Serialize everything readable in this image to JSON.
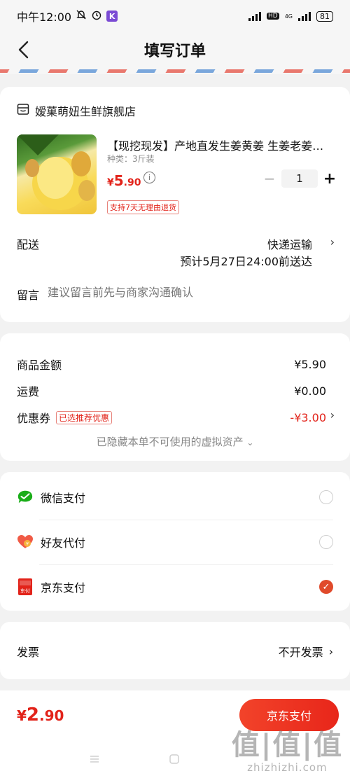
{
  "status_bar": {
    "time": "中午12:00",
    "hd_label": "HD",
    "net_label": "4G",
    "battery": "81"
  },
  "header": {
    "title": "填写订单"
  },
  "store": {
    "name": "嫒菓萌妞生鲜旗舰店",
    "product": {
      "title": "【现挖现发】产地直发生姜黄姜 生姜老姜…",
      "spec": "种类：3斤装",
      "price_currency": "¥",
      "price_int": "5",
      "price_dec": ".90",
      "return_policy": "支持7天无理由退货",
      "quantity": "1"
    },
    "delivery": {
      "label": "配送",
      "method": "快递运输",
      "eta": "预计5月27日24:00前送达"
    },
    "note": {
      "label": "留言",
      "placeholder": "建议留言前先与商家沟通确认"
    }
  },
  "summary": {
    "goods_label": "商品金额",
    "goods_value": "¥5.90",
    "shipping_label": "运费",
    "shipping_value": "¥0.00",
    "coupon_label": "优惠券",
    "coupon_tag": "已选推荐优惠",
    "coupon_value": "-¥3.00",
    "hidden_assets": "已隐藏本单不可使用的虚拟资产"
  },
  "payment": {
    "options": [
      {
        "label": "微信支付",
        "icon": "wechat-pay-icon",
        "selected": false
      },
      {
        "label": "好友代付",
        "icon": "friend-pay-icon",
        "selected": false
      },
      {
        "label": "京东支付",
        "icon": "jd-pay-icon",
        "selected": true
      }
    ],
    "jd_icon_text": "东付"
  },
  "invoice": {
    "label": "发票",
    "value": "不开发票"
  },
  "footer": {
    "total_currency": "¥",
    "total_int": "2",
    "total_dec": ".90",
    "pay_button": "京东支付"
  },
  "watermark": {
    "big": "值|值|值",
    "small": "zhizhizhi.com"
  },
  "colors": {
    "accent": "#e2231a",
    "pay_button": "#f2432a",
    "wechat": "#1aad19"
  }
}
